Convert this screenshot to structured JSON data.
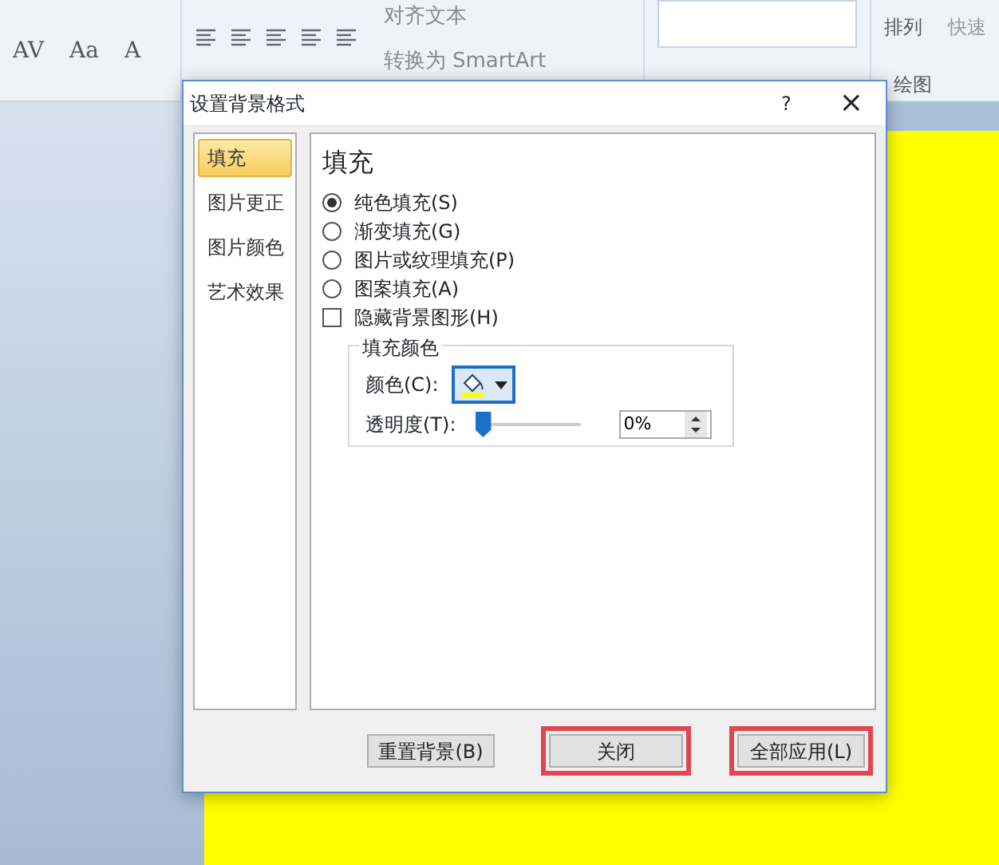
{
  "ribbon": {
    "font_tools": [
      {
        "label": "AV"
      },
      {
        "label": "Aa"
      },
      {
        "label": "A"
      }
    ],
    "paragraph_commands": [
      {
        "label": "对齐文本"
      },
      {
        "label": "转换为 SmartArt"
      }
    ],
    "arrange": {
      "label": "排列"
    },
    "quick_styles": {
      "label": "快速"
    },
    "drawing_group": {
      "label": "绘图"
    }
  },
  "dialog": {
    "title": "设置背景格式",
    "help": "?",
    "close": "×",
    "nav": [
      {
        "label": "填充",
        "selected": true
      },
      {
        "label": "图片更正",
        "selected": false
      },
      {
        "label": "图片颜色",
        "selected": false
      },
      {
        "label": "艺术效果",
        "selected": false
      }
    ],
    "heading": "填充",
    "fill_options": [
      {
        "label": "纯色填充(S)",
        "selected": true
      },
      {
        "label": "渐变填充(G)",
        "selected": false
      },
      {
        "label": "图片或纹理填充(P)",
        "selected": false
      },
      {
        "label": "图案填充(A)",
        "selected": false
      }
    ],
    "hide_graphics": {
      "label": "隐藏背景图形(H)",
      "checked": false
    },
    "fill_color": {
      "title": "填充颜色",
      "color_label": "颜色(C):",
      "color": "#ffff00",
      "transparency_label": "透明度(T):",
      "level": 0,
      "reading": "0%"
    },
    "buttons": [
      {
        "label": "重置背景(B)",
        "highlighted": false
      },
      {
        "label": "关闭",
        "highlighted": true
      },
      {
        "label": "全部应用(L)",
        "highlighted": true
      }
    ]
  }
}
